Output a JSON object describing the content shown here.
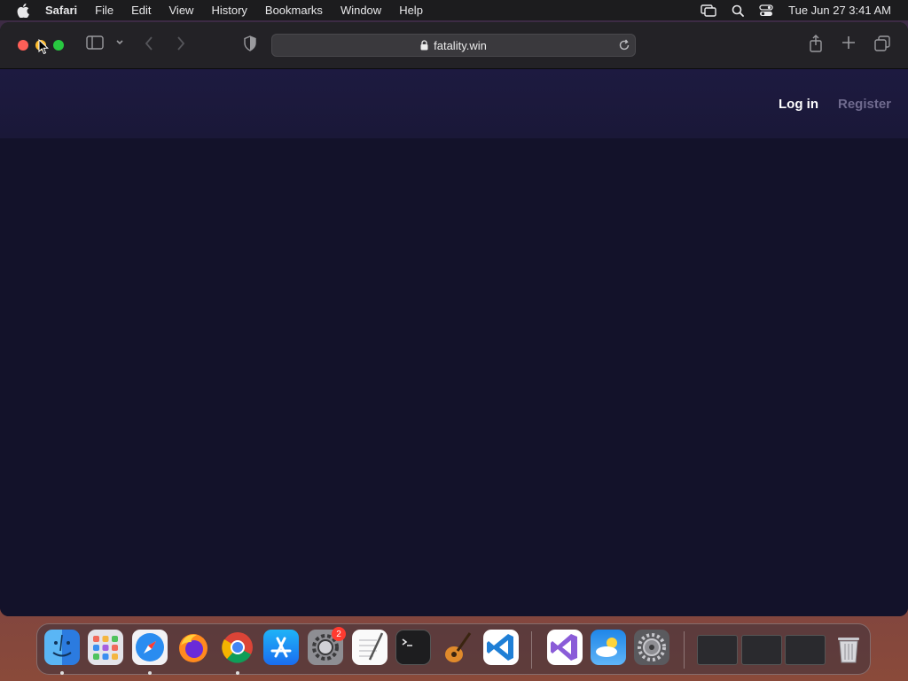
{
  "menubar": {
    "app_name": "Safari",
    "items": [
      "File",
      "Edit",
      "View",
      "History",
      "Bookmarks",
      "Window",
      "Help"
    ],
    "clock": "Tue Jun 27  3:41 AM"
  },
  "browser": {
    "url": "fatality.win"
  },
  "site": {
    "login_label": "Log in",
    "register_label": "Register"
  },
  "dock": {
    "apps": [
      "finder",
      "launchpad",
      "safari",
      "firefox",
      "chrome",
      "app-store",
      "system-preferences",
      "textedit",
      "terminal",
      "garageband",
      "vscode",
      "visual-studio",
      "weather",
      "settings"
    ],
    "settings_badge": "2"
  },
  "colors": {
    "page_bg": "#13122a",
    "header_bg": "#1d1a40",
    "register_color": "#6f6a8e"
  }
}
